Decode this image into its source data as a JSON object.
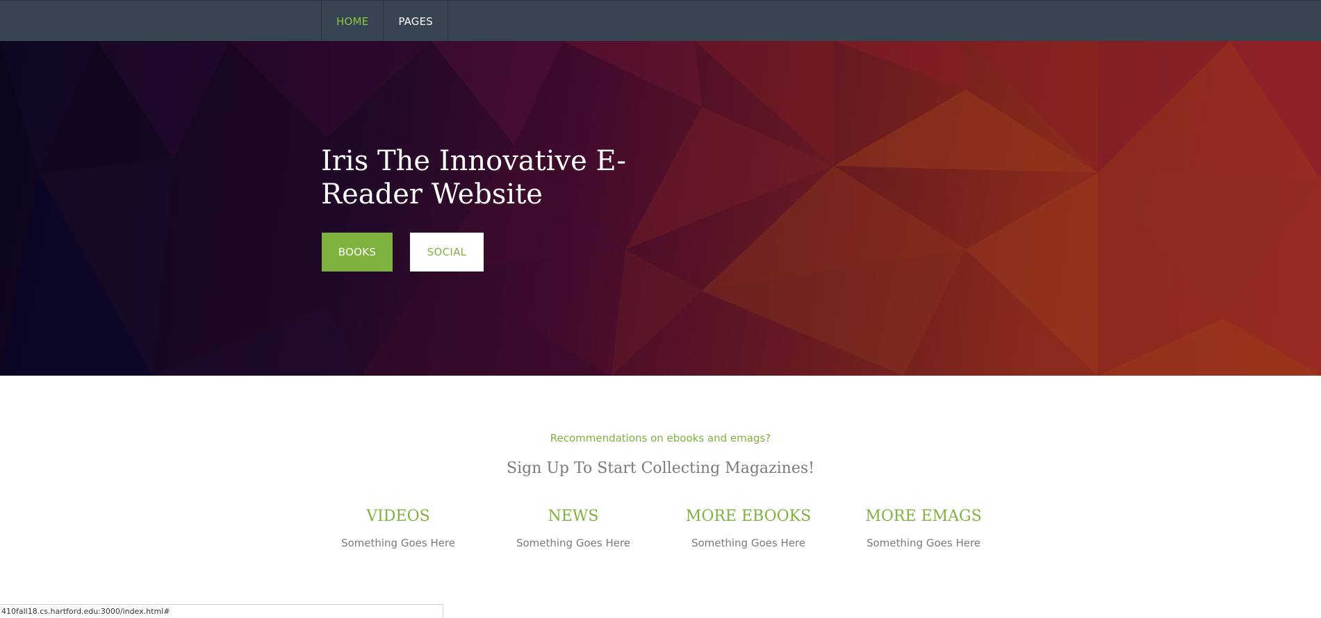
{
  "nav": {
    "items": [
      {
        "label": "HOME",
        "active": true
      },
      {
        "label": "PAGES",
        "active": false
      }
    ]
  },
  "hero": {
    "title": "Iris The Innovative E-Reader Website",
    "buttons": {
      "books": "BOOKS",
      "social": "SOCIAL"
    }
  },
  "content": {
    "intro_link": "Recommendations on ebooks and emags?",
    "heading": "Sign Up To Start Collecting Magazines!",
    "features": [
      {
        "title": "VIDEOS",
        "text": "Something Goes Here"
      },
      {
        "title": "NEWS",
        "text": "Something Goes Here"
      },
      {
        "title": "MORE EBOOKS",
        "text": "Something Goes Here"
      },
      {
        "title": "MORE EMAGS",
        "text": "Something Goes Here"
      }
    ]
  },
  "status_bar": {
    "url": "410fall18.cs.hartford.edu:3000/index.html#"
  },
  "colors": {
    "navbar": "#374451",
    "accent_green": "#7fb13e",
    "nav_active": "#8fc43f",
    "muted_text": "#7a7a7a"
  }
}
